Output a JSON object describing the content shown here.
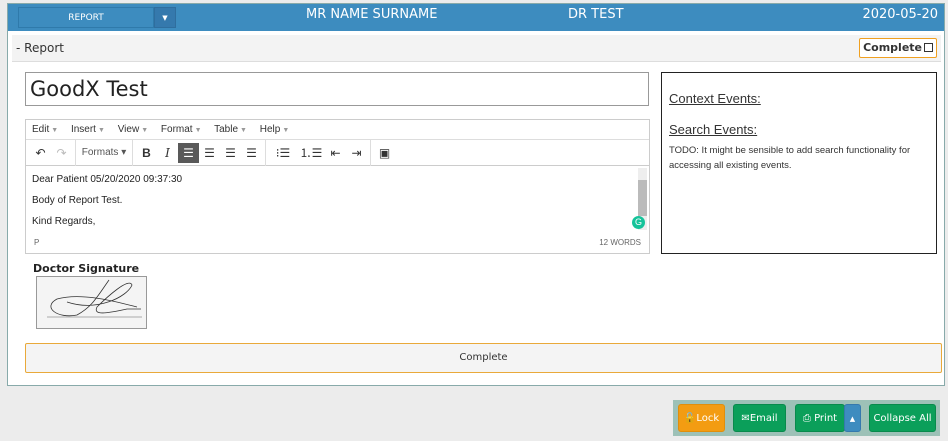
{
  "header": {
    "report_select": "REPORT",
    "patient": "MR NAME SURNAME",
    "doctor": "DR TEST",
    "date": "2020-05-20"
  },
  "section": {
    "toggle": "-",
    "title": "Report",
    "complete_label": "Complete"
  },
  "report_title": "GoodX Test",
  "editor": {
    "menu": [
      "Edit",
      "Insert",
      "View",
      "Format",
      "Table",
      "Help"
    ],
    "formats_label": "Formats",
    "lines": [
      "Dear Patient  05/20/2020 09:37:30",
      "Body of Report Test.",
      "Kind Regards,"
    ],
    "path": "P",
    "word_count": "12 WORDS"
  },
  "side": {
    "context_title": "Context Events:",
    "search_title": "Search Events:",
    "todo": "TODO: It might be sensible to add search functionality for accessing all existing events."
  },
  "signature_label": "Doctor Signature",
  "complete_button": "Complete",
  "actions": {
    "lock": "Lock",
    "email": "Email",
    "print": "Print",
    "collapse": "Collapse All"
  },
  "colors": {
    "header": "#3d8cbf",
    "green": "#0b9f5a",
    "orange": "#f39c12"
  }
}
